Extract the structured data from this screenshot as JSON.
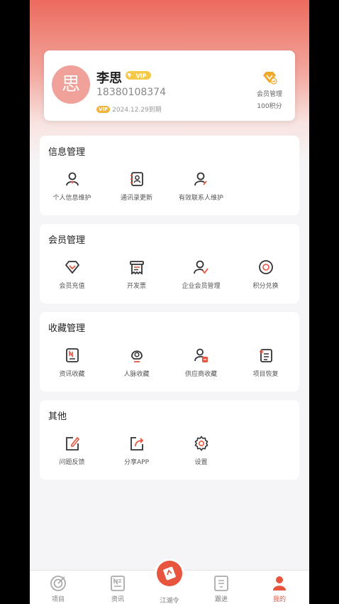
{
  "profile": {
    "avatar_char": "思",
    "name": "李思",
    "vip_badge": "VIP",
    "phone": "18380108374",
    "expire_badge": "VIP",
    "expire_text": "2024.12.29到期",
    "member_mgr_label": "会员管理",
    "points": "100积分"
  },
  "sections": {
    "info": {
      "title": "信息管理",
      "items": [
        "个人信息维护",
        "通讯录更新",
        "有效联系人维护"
      ]
    },
    "member": {
      "title": "会员管理",
      "items": [
        "会员充值",
        "开发票",
        "企业会员管理",
        "积分兑换"
      ]
    },
    "fav": {
      "title": "收藏管理",
      "items": [
        "资讯收藏",
        "人脉收藏",
        "供应商收藏",
        "项目恢复"
      ]
    },
    "other": {
      "title": "其他",
      "items": [
        "问题反馈",
        "分享APP",
        "设置"
      ]
    }
  },
  "tabbar": {
    "items": [
      "项目",
      "资讯",
      "江湖令",
      "跟进",
      "我的"
    ],
    "active": "我的"
  },
  "colors": {
    "accent": "#e8553f",
    "vip_gold": "#f1b43c",
    "avatar": "#f0a29a"
  }
}
